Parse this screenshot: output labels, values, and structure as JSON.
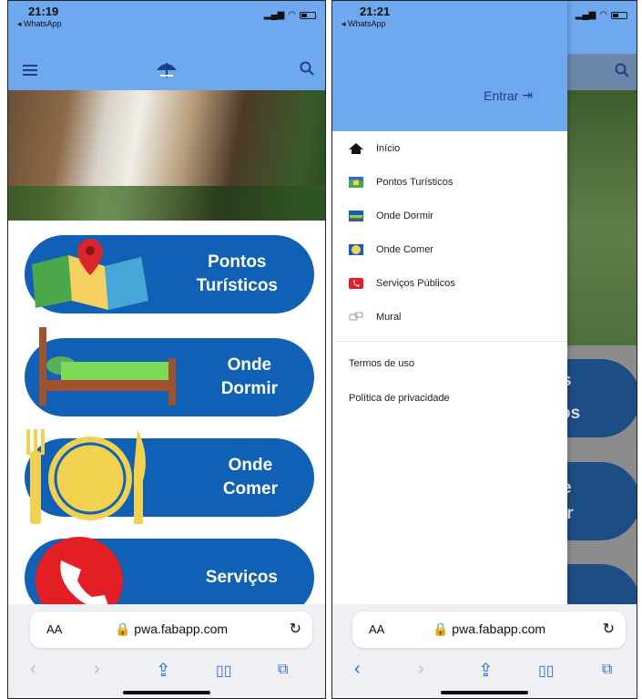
{
  "left_phone": {
    "status": {
      "time": "21:19",
      "back_app": "◂ WhatsApp"
    },
    "tiles": [
      {
        "line1": "Pontos",
        "line2": "Turísticos"
      },
      {
        "line1": "Onde",
        "line2": "Dormir"
      },
      {
        "line1": "Onde",
        "line2": "Comer"
      },
      {
        "line1": "Serviços",
        "line2": ""
      }
    ],
    "browser": {
      "aa": "AA",
      "url": "pwa.fabapp.com"
    }
  },
  "right_phone": {
    "status": {
      "time": "21:21",
      "back_app": "◂ WhatsApp"
    },
    "drawer": {
      "login_label": "Entrar",
      "menu": [
        {
          "label": "Início",
          "icon": "home-icon"
        },
        {
          "label": "Pontos Turísticos",
          "icon": "map-icon"
        },
        {
          "label": "Onde Dormir",
          "icon": "bed-icon"
        },
        {
          "label": "Onde Comer",
          "icon": "plate-icon"
        },
        {
          "label": "Serviços Públicos",
          "icon": "phone-icon"
        },
        {
          "label": "Mural",
          "icon": "chat-icon"
        }
      ],
      "terms": "Termos de uso",
      "privacy": "Política de privacidade"
    },
    "behind": {
      "a": "s",
      "b": "os",
      "c": "e",
      "d": "ir"
    },
    "browser": {
      "aa": "AA",
      "url": "pwa.fabapp.com"
    }
  },
  "colors": {
    "appbar": "#6ea8ef",
    "tile": "#1060b5",
    "link": "#2a6bd8"
  }
}
